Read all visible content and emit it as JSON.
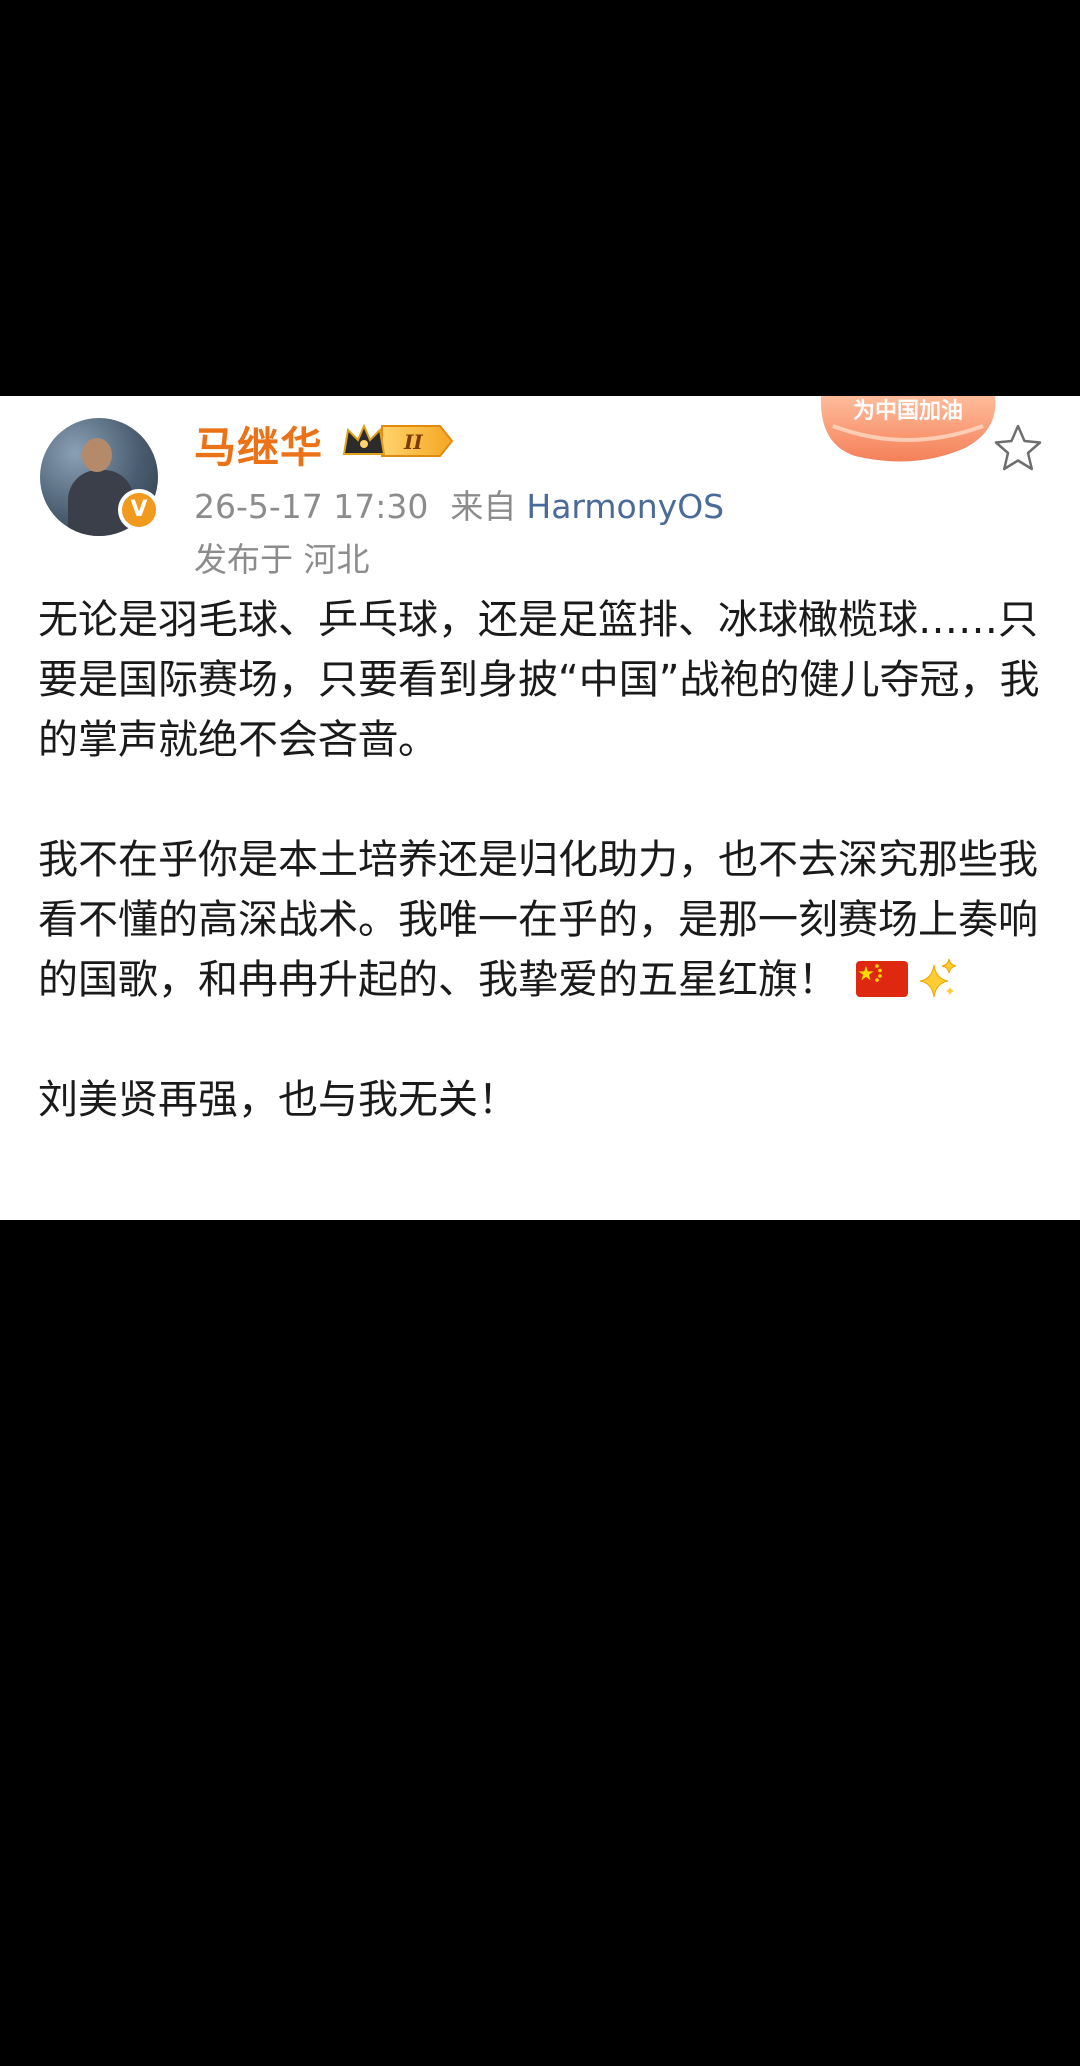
{
  "post": {
    "author": {
      "name": "马继华",
      "vip_level": "II",
      "verified_mark": "V"
    },
    "timestamp": "26-5-17 17:30",
    "source_prefix": "来自",
    "source": "HarmonyOS",
    "location": "发布于 河北",
    "promo_badge_text": "为中国加油",
    "paragraphs": [
      "无论是羽毛球、乒乓球，还是足篮排、冰球橄榄球……只要是国际赛场，只要看到身披“中国”战袍的健儿夺冠，我的掌声就绝不会吝啬。",
      "我不在乎你是本土培养还是归化助力，也不去深究那些我看不懂的高深战术。我唯一在乎的，是那一刻赛场上奏响的国歌，和冉冉升起的、我挚爱的五星红旗！",
      "刘美贤再强，也与我无关！"
    ]
  },
  "icons": {
    "favorite": "star-outline-icon",
    "flag": "china-flag-emoji",
    "sparkles": "sparkles-emoji"
  },
  "colors": {
    "username": "#eb7216",
    "source_link": "#4a6a9a",
    "meta_text": "#8c8c8c",
    "body_text": "#1a1a1a",
    "verified_badge": "#f29a1e",
    "background": "#000000",
    "card": "#ffffff"
  }
}
